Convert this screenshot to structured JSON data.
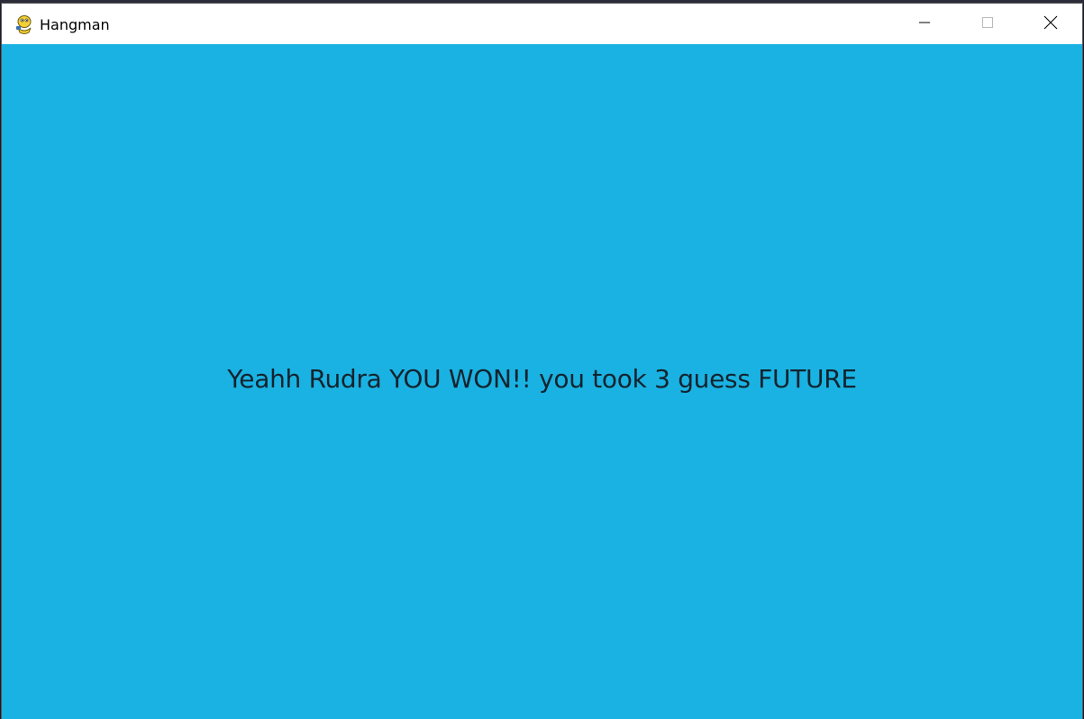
{
  "window": {
    "title": "Hangman",
    "app_icon": "pygame-snake-icon",
    "controls": {
      "minimize_icon": "minimize-icon",
      "maximize_icon": "maximize-icon",
      "close_icon": "close-icon"
    }
  },
  "game": {
    "message": "Yeahh Rudra YOU WON!! you took 3 guess FUTURE",
    "background_color": "#1ab2e2",
    "text_color": "#13232e"
  }
}
